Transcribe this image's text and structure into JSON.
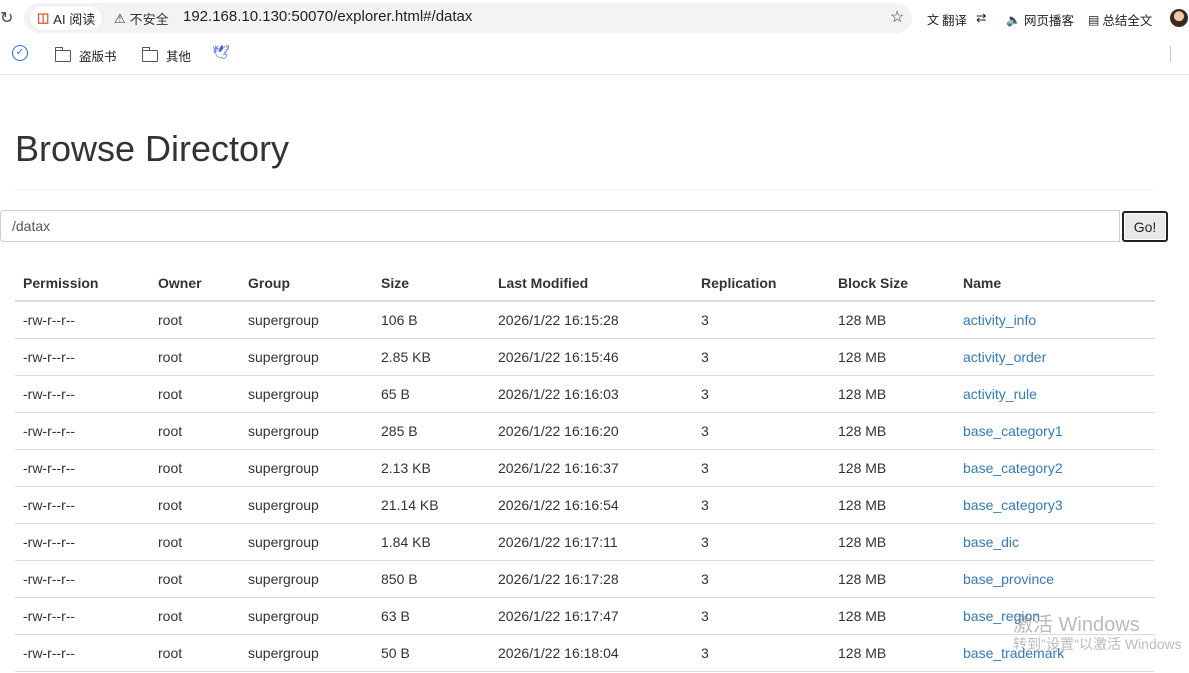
{
  "browser": {
    "ai_chip": "AI 阅读",
    "security_label": "不安全",
    "url": "192.168.10.130:50070/explorer.html#/datax",
    "tools": {
      "translate": "翻译",
      "read_aloud": "网页播客",
      "summarize": "总结全文"
    },
    "bookmarks": [
      {
        "label": "盗版书",
        "icon": "folder-icon"
      },
      {
        "label": "其他",
        "icon": "folder-icon"
      }
    ]
  },
  "page": {
    "title": "Browse Directory",
    "path_value": "/datax",
    "go_label": "Go!"
  },
  "table": {
    "headers": [
      "Permission",
      "Owner",
      "Group",
      "Size",
      "Last Modified",
      "Replication",
      "Block Size",
      "Name"
    ],
    "rows": [
      [
        "-rw-r--r--",
        "root",
        "supergroup",
        "106 B",
        "2026/1/22 16:15:28",
        "3",
        "128 MB",
        "activity_info"
      ],
      [
        "-rw-r--r--",
        "root",
        "supergroup",
        "2.85 KB",
        "2026/1/22 16:15:46",
        "3",
        "128 MB",
        "activity_order"
      ],
      [
        "-rw-r--r--",
        "root",
        "supergroup",
        "65 B",
        "2026/1/22 16:16:03",
        "3",
        "128 MB",
        "activity_rule"
      ],
      [
        "-rw-r--r--",
        "root",
        "supergroup",
        "285 B",
        "2026/1/22 16:16:20",
        "3",
        "128 MB",
        "base_category1"
      ],
      [
        "-rw-r--r--",
        "root",
        "supergroup",
        "2.13 KB",
        "2026/1/22 16:16:37",
        "3",
        "128 MB",
        "base_category2"
      ],
      [
        "-rw-r--r--",
        "root",
        "supergroup",
        "21.14 KB",
        "2026/1/22 16:16:54",
        "3",
        "128 MB",
        "base_category3"
      ],
      [
        "-rw-r--r--",
        "root",
        "supergroup",
        "1.84 KB",
        "2026/1/22 16:17:11",
        "3",
        "128 MB",
        "base_dic"
      ],
      [
        "-rw-r--r--",
        "root",
        "supergroup",
        "850 B",
        "2026/1/22 16:17:28",
        "3",
        "128 MB",
        "base_province"
      ],
      [
        "-rw-r--r--",
        "root",
        "supergroup",
        "63 B",
        "2026/1/22 16:17:47",
        "3",
        "128 MB",
        "base_region"
      ],
      [
        "-rw-r--r--",
        "root",
        "supergroup",
        "50 B",
        "2026/1/22 16:18:04",
        "3",
        "128 MB",
        "base_trademark"
      ]
    ]
  },
  "watermark": {
    "line1": "激活 Windows",
    "line2": "转到\"设置\"以激活 Windows"
  },
  "colors": {
    "link": "#337ab7",
    "ai_icon": "#e8542a"
  }
}
